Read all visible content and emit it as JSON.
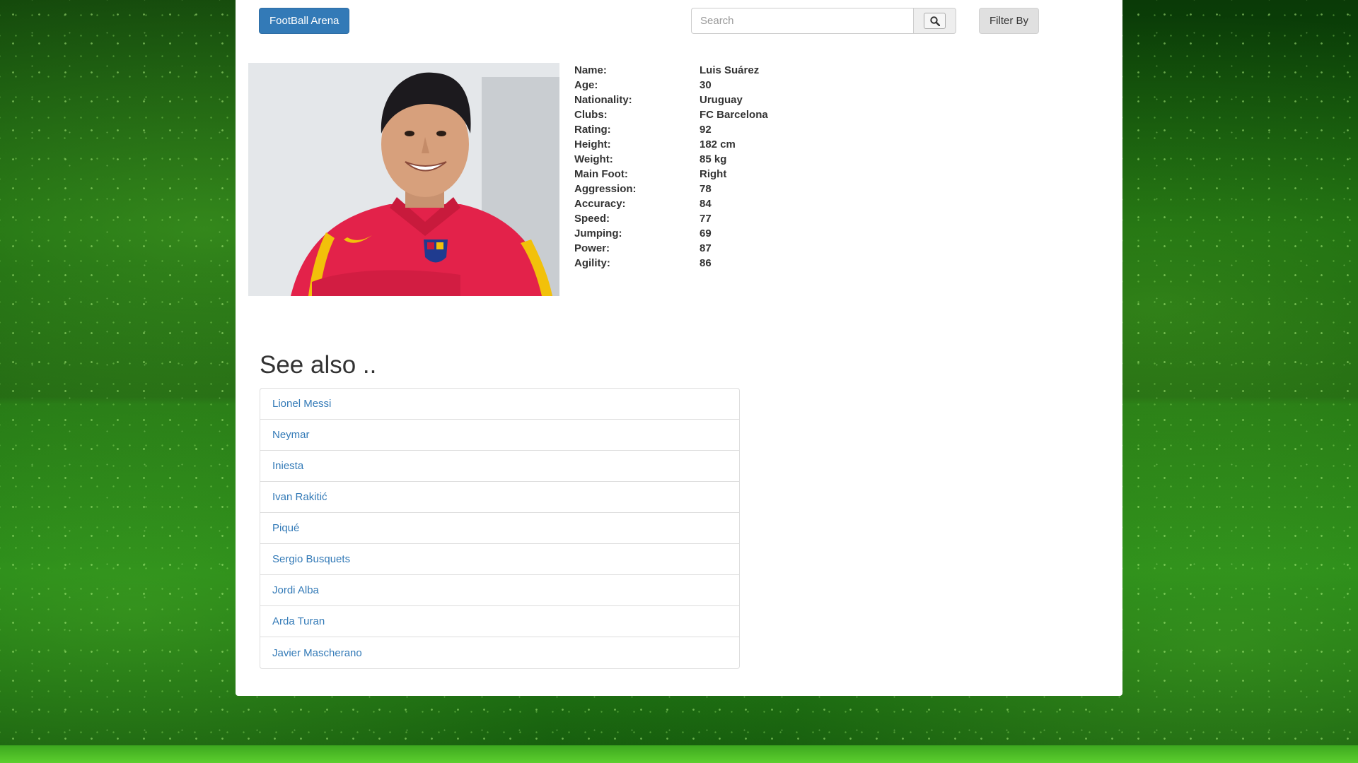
{
  "header": {
    "brand_label": "FootBall Arena",
    "search_placeholder": "Search",
    "filter_label": "Filter By"
  },
  "player": {
    "stats": [
      {
        "label": "Name:",
        "value": "Luis Suárez"
      },
      {
        "label": "Age:",
        "value": "30"
      },
      {
        "label": "Nationality:",
        "value": "Uruguay"
      },
      {
        "label": "Clubs:",
        "value": "FC Barcelona"
      },
      {
        "label": "Rating:",
        "value": "92"
      },
      {
        "label": "Height:",
        "value": "182 cm"
      },
      {
        "label": "Weight:",
        "value": "85 kg"
      },
      {
        "label": "Main Foot:",
        "value": "Right"
      },
      {
        "label": "Aggression:",
        "value": "78"
      },
      {
        "label": "Accuracy:",
        "value": "84"
      },
      {
        "label": "Speed:",
        "value": "77"
      },
      {
        "label": "Jumping:",
        "value": "69"
      },
      {
        "label": "Power:",
        "value": "87"
      },
      {
        "label": "Agility:",
        "value": "86"
      }
    ]
  },
  "see_also": {
    "title": "See also ..",
    "items": [
      "Lionel Messi",
      "Neymar",
      "Iniesta",
      "Ivan Rakitić",
      "Piqué",
      "Sergio Busquets",
      "Jordi Alba",
      "Arda Turan",
      "Javier Mascherano"
    ]
  },
  "icons": {
    "search": "search-icon"
  },
  "colors": {
    "primary": "#337ab7",
    "background_green": "#0f5a0a"
  }
}
